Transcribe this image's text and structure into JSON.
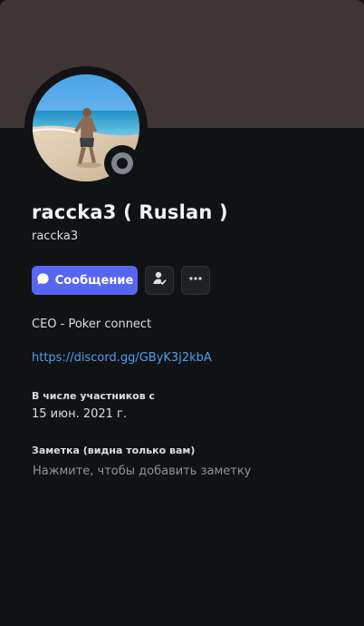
{
  "profile": {
    "display_name": "raccka3 ( Ruslan )",
    "username": "raccka3",
    "status": "offline",
    "banner_color": "#3f3534"
  },
  "actions": {
    "message_label": "Сообщение",
    "message_icon": "chat-bubble-icon",
    "friend_icon": "person-check-icon",
    "more_icon": "more-dots-icon",
    "accent_color": "#5865f2"
  },
  "about": {
    "bio": "CEO - Poker connect",
    "link": "https://discord.gg/GByK3j2kbA"
  },
  "member_since": {
    "label": "В числе участников с",
    "date": "15 июн. 2021 г."
  },
  "note": {
    "label": "Заметка (видна только вам)",
    "placeholder": "Нажмите, чтобы добавить заметку"
  }
}
